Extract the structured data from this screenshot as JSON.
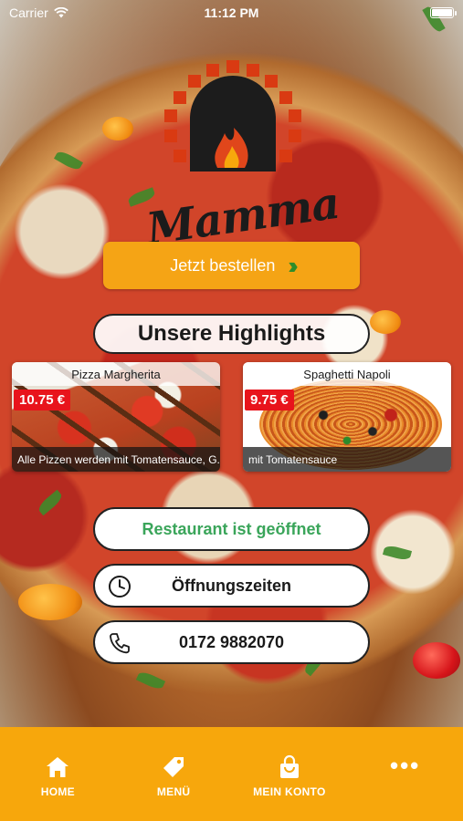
{
  "status_bar": {
    "carrier": "Carrier",
    "time": "11:12 PM"
  },
  "brand": {
    "name": "Mamma"
  },
  "order_button": {
    "label": "Jetzt bestellen"
  },
  "highlights": {
    "title": "Unsere Highlights",
    "items": [
      {
        "name": "Pizza Margherita",
        "price": "10.75 €",
        "description": "Alle Pizzen werden mit Tomatensauce, G..."
      },
      {
        "name": "Spaghetti Napoli",
        "price": "9.75 €",
        "description": "mit Tomatensauce"
      }
    ]
  },
  "info": {
    "status": "Restaurant ist geöffnet",
    "status_color": "#3aa55a",
    "hours_label": "Öffnungszeiten",
    "phone": "0172 9882070"
  },
  "tab_bar": {
    "color": "#f7a70c",
    "items": [
      {
        "label": "HOME",
        "icon": "home-icon"
      },
      {
        "label": "MENÜ",
        "icon": "tag-icon"
      },
      {
        "label": "MEIN KONTO",
        "icon": "bag-icon"
      },
      {
        "label": "",
        "icon": "more-icon"
      }
    ]
  }
}
